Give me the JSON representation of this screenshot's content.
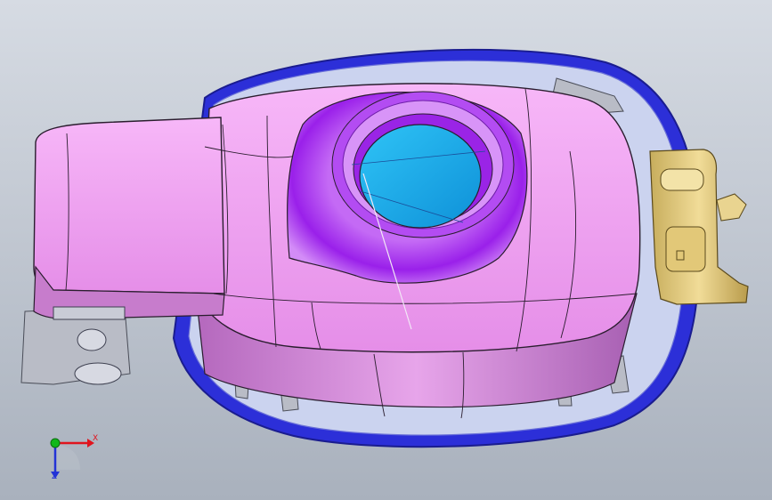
{
  "viewport": {
    "background_top": "#d6dbe3",
    "background_bottom": "#a9b1bd"
  },
  "model": {
    "housing_color": "#f3a0f5",
    "housing_shadow": "#c97ad0",
    "rim_color": "#2c2fd8",
    "bowl_color": "#a22cf0",
    "opening_color": "#1fb0f0",
    "hinge_color": "#e8cf82",
    "clip_color": "#b9bcc6",
    "edge_color": "#2a1d2e"
  },
  "triad": {
    "x_label": "X",
    "z_label": "Z",
    "x_color": "#e0141e",
    "y_color": "#12b81a",
    "z_color": "#2333d6"
  }
}
